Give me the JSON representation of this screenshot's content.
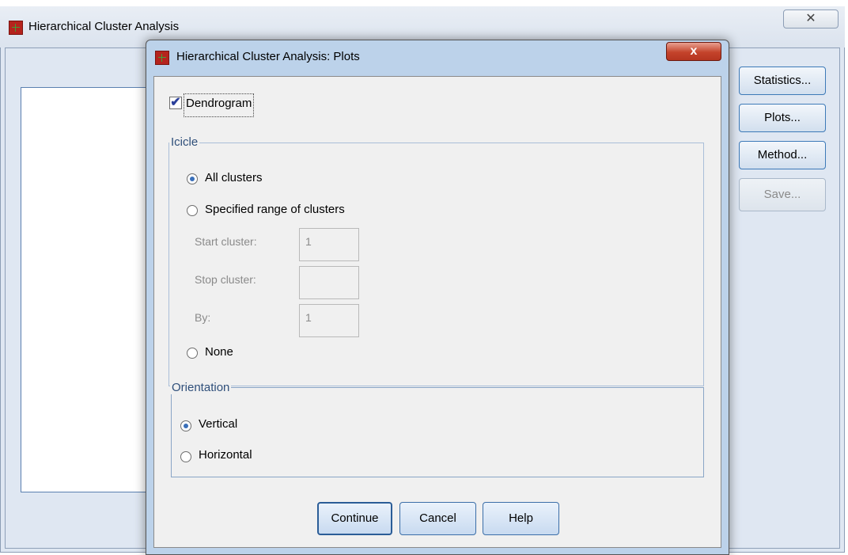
{
  "background_window": {
    "title": "Hierarchical Cluster Analysis",
    "close_glyph": "✕",
    "buttons": {
      "statistics": "Statistics...",
      "plots": "Plots...",
      "method": "Method...",
      "save": "Save..."
    }
  },
  "dialog": {
    "title": "Hierarchical Cluster Analysis: Plots",
    "close_glyph": "x",
    "dendrogram": {
      "label": "Dendrogram",
      "checked": true,
      "check_glyph": "✔"
    },
    "icicle": {
      "legend": "Icicle",
      "all_clusters": "All clusters",
      "specified_range": "Specified range of clusters",
      "start_cluster_label": "Start cluster:",
      "start_cluster_value": "1",
      "stop_cluster_label": "Stop cluster:",
      "stop_cluster_value": "",
      "by_label": "By:",
      "by_value": "1",
      "none": "None",
      "selected": "All clusters"
    },
    "orientation": {
      "legend": "Orientation",
      "vertical": "Vertical",
      "horizontal": "Horizontal",
      "selected": "Vertical"
    },
    "buttons": {
      "continue": "Continue",
      "cancel": "Cancel",
      "help": "Help"
    }
  },
  "icons": {
    "app_icon": "spss-table-icon",
    "close_icon": "close-icon"
  }
}
